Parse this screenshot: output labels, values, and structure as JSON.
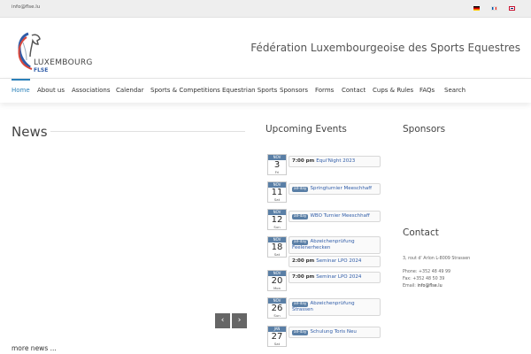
{
  "topbar": {
    "email": "info@flse.lu"
  },
  "header": {
    "logo_line1": "LUXEMBOURG",
    "logo_line2": "FLSE",
    "site_title": "Fédération Luxembourgeoise des Sports Equestres"
  },
  "nav": {
    "items": [
      {
        "label": "Home"
      },
      {
        "label": "About us"
      },
      {
        "label": "Associations"
      },
      {
        "label": "Calendar"
      },
      {
        "label": "Sports & Competitions"
      },
      {
        "label": "Equestrian Sports"
      },
      {
        "label": "Sponsors"
      },
      {
        "label": "Forms"
      },
      {
        "label": "Contact"
      },
      {
        "label": "Cups & Rules"
      },
      {
        "label": "FAQs"
      },
      {
        "label": "Search"
      }
    ],
    "active": "Home"
  },
  "news": {
    "title": "News",
    "more": "more news ...",
    "prev": "‹",
    "next": "›"
  },
  "events": {
    "title": "Upcoming Events",
    "days": [
      {
        "mon": "NOV",
        "day": "3",
        "dow": "Fri",
        "items": [
          {
            "time": "7:00 pm",
            "tag": "",
            "title": "Equi'Night 2023"
          }
        ]
      },
      {
        "mon": "NOV",
        "day": "11",
        "dow": "Sat",
        "items": [
          {
            "time": "",
            "tag": "all-day",
            "title": "Springturnier Meeschhaff"
          }
        ]
      },
      {
        "mon": "NOV",
        "day": "12",
        "dow": "Sun",
        "items": [
          {
            "time": "",
            "tag": "all-day",
            "title": "WBO Turnier Meeschhaff"
          }
        ]
      },
      {
        "mon": "NOV",
        "day": "18",
        "dow": "Sat",
        "items": [
          {
            "time": "",
            "tag": "all-day",
            "title": "Abzeichenprüfung Feelenerhecken"
          },
          {
            "time": "2:00 pm",
            "tag": "",
            "title": "Seminar LPO 2024"
          }
        ]
      },
      {
        "mon": "NOV",
        "day": "20",
        "dow": "Mon",
        "items": [
          {
            "time": "7:00 pm",
            "tag": "",
            "title": "Seminar LPO 2024"
          }
        ]
      },
      {
        "mon": "NOV",
        "day": "26",
        "dow": "Sun",
        "items": [
          {
            "time": "",
            "tag": "all-day",
            "title": "Abzeichenprüfung Strassen"
          }
        ]
      },
      {
        "mon": "JAN",
        "day": "27",
        "dow": "Sat",
        "items": [
          {
            "time": "",
            "tag": "all-day",
            "title": "Schulung Toris Neu"
          }
        ]
      }
    ]
  },
  "sponsors": {
    "title": "Sponsors"
  },
  "contact": {
    "title": "Contact",
    "address": "3, rout d' Arlon L-8009 Strassen",
    "phone": "Phone: +352 48 49 99",
    "fax": "Fax: +352 48 50 39",
    "email_label": "Email:",
    "email": "info@flse.lu"
  },
  "colors": {
    "accent": "#2a80b9",
    "badge": "#5a7fa6",
    "link": "#2f5ca8"
  }
}
